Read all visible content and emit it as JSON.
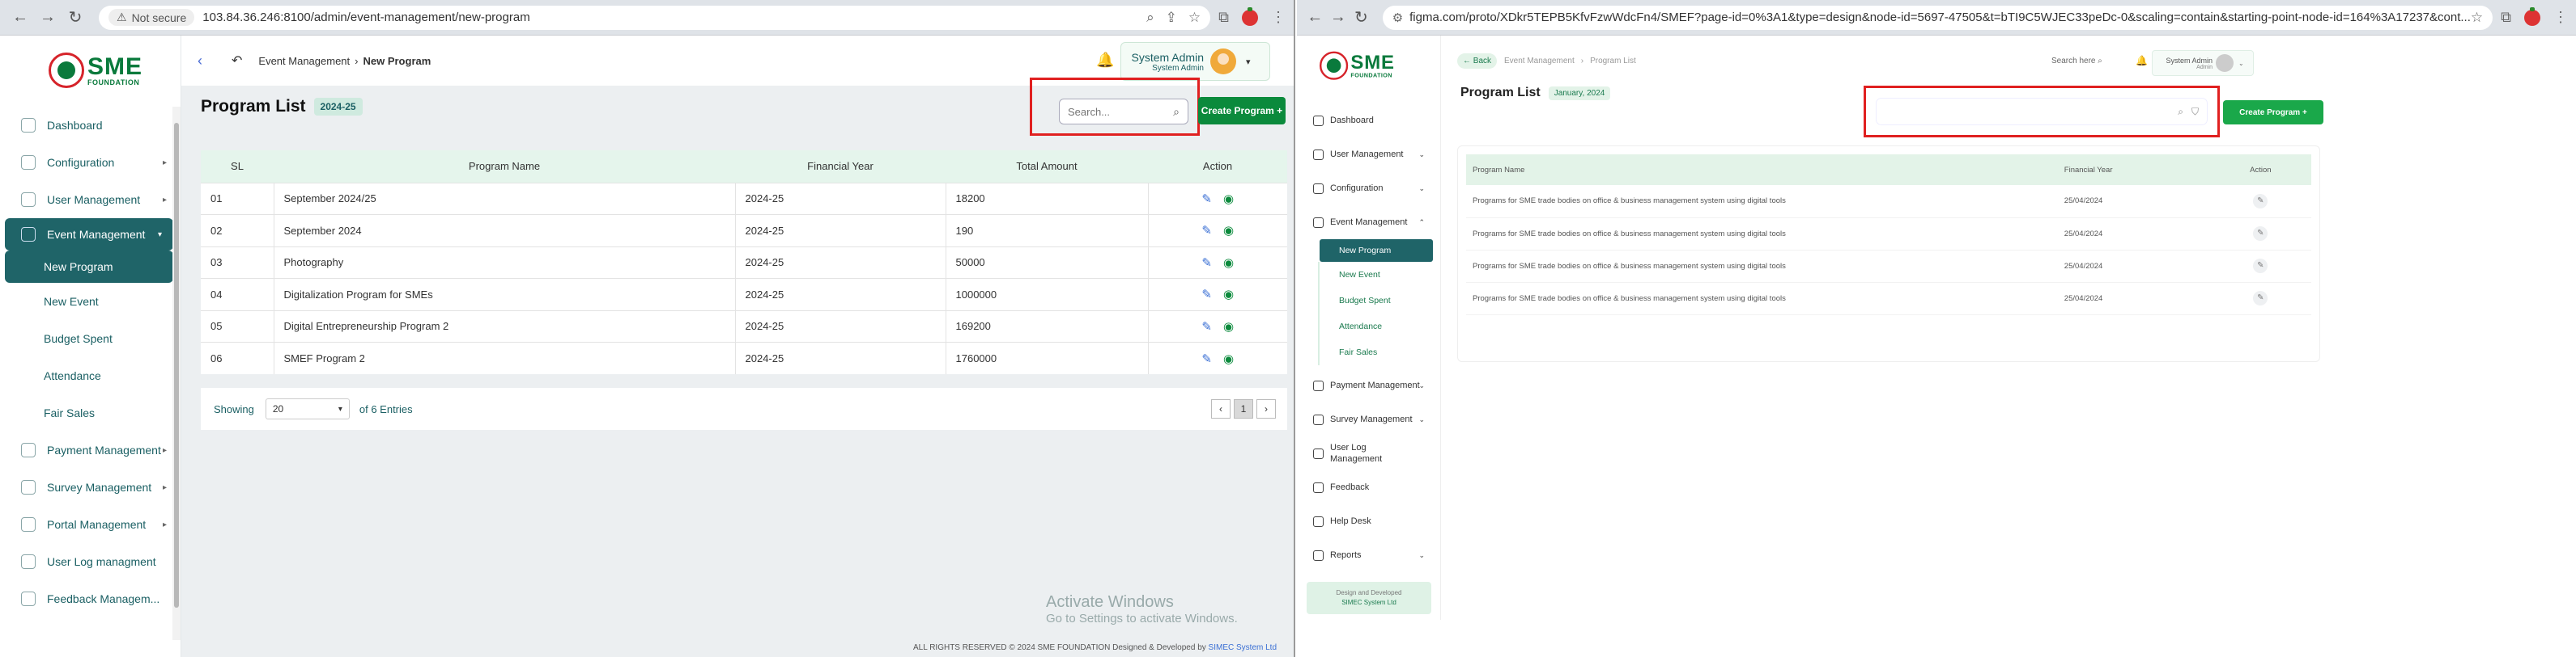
{
  "left": {
    "browser": {
      "not_secure": "Not secure",
      "url": "103.84.36.246:8100/admin/event-management/new-program"
    },
    "logo": {
      "sme": "SME",
      "sub": "FOUNDATION"
    },
    "sidebar": {
      "items": [
        {
          "label": "Dashboard"
        },
        {
          "label": "Configuration"
        },
        {
          "label": "User Management"
        },
        {
          "label": "Event Management"
        },
        {
          "label": "New Program"
        },
        {
          "label": "New Event"
        },
        {
          "label": "Budget Spent"
        },
        {
          "label": "Attendance"
        },
        {
          "label": "Fair Sales"
        },
        {
          "label": "Payment Management"
        },
        {
          "label": "Survey Management"
        },
        {
          "label": "Portal Management"
        },
        {
          "label": "User Log managment"
        },
        {
          "label": "Feedback Managem..."
        }
      ]
    },
    "header": {
      "breadcrumb_parent": "Event Management",
      "breadcrumb_current": "New Program",
      "user_name": "System Admin",
      "user_role": "System Admin"
    },
    "main": {
      "title": "Program List",
      "badge": "2024-25",
      "search_placeholder": "Search...",
      "create_label": "Create Program +",
      "columns": [
        "SL",
        "Program Name",
        "Financial Year",
        "Total Amount",
        "Action"
      ],
      "rows": [
        {
          "sl": "01",
          "name": "September 2024/25",
          "fy": "2024-25",
          "amount": "18200"
        },
        {
          "sl": "02",
          "name": "September 2024",
          "fy": "2024-25",
          "amount": "190"
        },
        {
          "sl": "03",
          "name": "Photography",
          "fy": "2024-25",
          "amount": "50000"
        },
        {
          "sl": "04",
          "name": "Digitalization Program for SMEs",
          "fy": "2024-25",
          "amount": "1000000"
        },
        {
          "sl": "05",
          "name": "Digital Entrepreneurship Program 2",
          "fy": "2024-25",
          "amount": "169200"
        },
        {
          "sl": "06",
          "name": "SMEF Program 2",
          "fy": "2024-25",
          "amount": "1760000"
        }
      ],
      "showing": "Showing",
      "page_size": "20",
      "entries": "of 6 Entries",
      "page": "1"
    },
    "activate": {
      "line1": "Activate Windows",
      "line2": "Go to Settings to activate Windows."
    },
    "copyright": "ALL RIGHTS RESERVED © 2024 SME FOUNDATION   Designed & Developed by",
    "copyright_company": "SIMEC System Ltd"
  },
  "right": {
    "browser": {
      "url": "figma.com/proto/XDkr5TEPB5KfvFzwWdcFn4/SMEF?page-id=0%3A1&type=design&node-id=5697-47505&t=bTI9C5WJEC33peDc-0&scaling=contain&starting-point-node-id=164%3A17237&cont..."
    },
    "logo": {
      "sme": "SME",
      "sub": "FOUNDATION"
    },
    "sidebar": {
      "items": [
        {
          "label": "Dashboard"
        },
        {
          "label": "User Management"
        },
        {
          "label": "Configuration"
        },
        {
          "label": "Event Management"
        },
        {
          "label": "New Program"
        },
        {
          "label": "New Event"
        },
        {
          "label": "Budget Spent"
        },
        {
          "label": "Attendance"
        },
        {
          "label": "Fair Sales"
        },
        {
          "label": "Payment Management"
        },
        {
          "label": "Survey Management"
        },
        {
          "label": "User Log Management"
        },
        {
          "label": "Feedback"
        },
        {
          "label": "Help Desk"
        },
        {
          "label": "Reports"
        }
      ],
      "credit_line1": "Design and Developed",
      "credit_line2": "SIMEC System Ltd"
    },
    "header": {
      "back": "Back",
      "breadcrumb_parent": "Event Management",
      "breadcrumb_current": "Program List",
      "search_here": "Search here",
      "user_name": "System Admin",
      "user_role": "Admin"
    },
    "main": {
      "title": "Program List",
      "badge": "January, 2024",
      "create_label": "Create Program +",
      "columns": [
        "Program Name",
        "Financial Year",
        "Action"
      ],
      "rows": [
        {
          "name": "Programs for SME trade bodies on office & business management system using digital tools",
          "fy": "25/04/2024"
        },
        {
          "name": "Programs for SME trade bodies on office & business management system using digital tools",
          "fy": "25/04/2024"
        },
        {
          "name": "Programs for SME trade bodies on office & business management system using digital tools",
          "fy": "25/04/2024"
        },
        {
          "name": "Programs for SME trade bodies on office & business management system using digital tools",
          "fy": "25/04/2024"
        }
      ]
    }
  },
  "colors": {
    "brand_green": "#0b8a3c",
    "brand_teal": "#1f6468",
    "brand_red": "#d6232a",
    "highlight_frame": "#e02020"
  }
}
